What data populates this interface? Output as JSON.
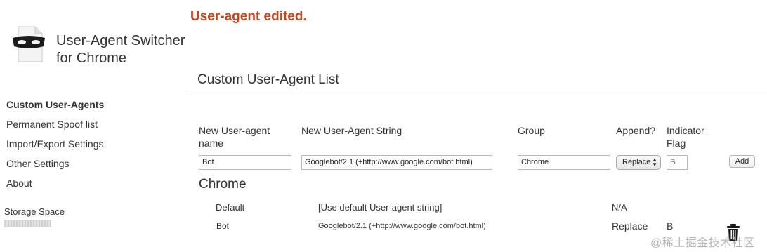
{
  "status_message": "User-agent edited.",
  "app": {
    "title_line1": "User-Agent Switcher",
    "title_line2": "for Chrome"
  },
  "sidebar": {
    "items": [
      {
        "label": "Custom User-Agents"
      },
      {
        "label": "Permanent Spoof list"
      },
      {
        "label": "Import/Export Settings"
      },
      {
        "label": "Other Settings"
      },
      {
        "label": "About"
      }
    ],
    "storage_label": "Storage Space"
  },
  "main": {
    "title": "Custom User-Agent List",
    "columns": {
      "name": "New User-agent name",
      "string": "New User-Agent String",
      "group": "Group",
      "append": "Append?",
      "flag": "Indicator Flag"
    },
    "form": {
      "name_value": "Bot",
      "string_value": "Googlebot/2.1 (+http://www.google.com/bot.html)",
      "group_value": "Chrome",
      "append_value": "Replace",
      "flag_value": "B",
      "add_label": "Add"
    },
    "group_title": "Chrome",
    "rows": [
      {
        "name": "Default",
        "string": "[Use default User-agent string]",
        "append": "N/A",
        "flag": ""
      },
      {
        "name": "Bot",
        "string": "Googlebot/2.1 (+http://www.google.com/bot.html)",
        "append": "Replace",
        "flag": "B"
      }
    ]
  },
  "watermark": "@稀土掘金技术社区",
  "icons": [
    "mask-logo-icon",
    "select-arrows-icon",
    "trash-icon"
  ]
}
